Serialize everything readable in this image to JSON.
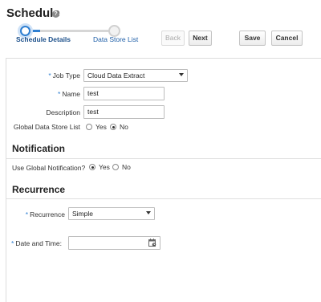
{
  "header": {
    "title": "Schedule",
    "help_icon": "help-icon"
  },
  "train": {
    "steps": [
      {
        "label": "Schedule Details",
        "state": "current"
      },
      {
        "label": "Data Store List",
        "state": "next"
      }
    ]
  },
  "toolbar": {
    "back_label": "Back",
    "next_label": "Next",
    "save_label": "Save",
    "cancel_label": "Cancel"
  },
  "form": {
    "job_type": {
      "label": "Job Type",
      "required": "*",
      "value": "Cloud Data Extract"
    },
    "name": {
      "label": "Name",
      "required": "*",
      "value": "test"
    },
    "description": {
      "label": "Description",
      "value": "test"
    },
    "global_data_store_list": {
      "label": "Global Data Store List",
      "options": [
        "Yes",
        "No"
      ],
      "selected": "No"
    }
  },
  "notification": {
    "title": "Notification",
    "use_global": {
      "label": "Use Global Notification?",
      "options": [
        "Yes",
        "No"
      ],
      "selected": "Yes"
    }
  },
  "recurrence": {
    "title": "Recurrence",
    "recurrence_field": {
      "label": "Recurrence",
      "required": "*",
      "value": "Simple"
    },
    "date_time": {
      "label": "Date and Time:",
      "required": "*",
      "value": "",
      "icon": "calendar-icon"
    }
  },
  "colors": {
    "accent": "#2f7fd1",
    "link": "#1f5fa8"
  }
}
